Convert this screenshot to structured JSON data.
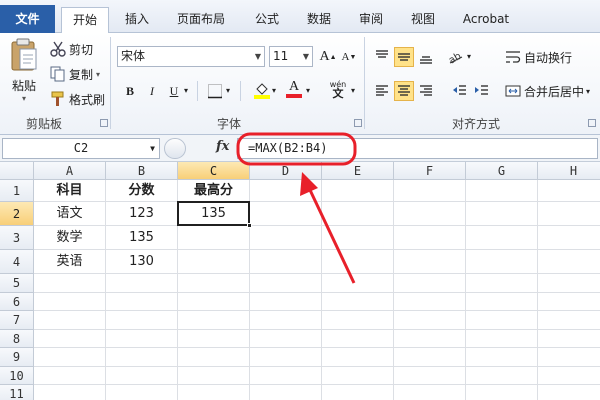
{
  "tabs": [
    {
      "label": "文件"
    },
    {
      "label": "开始"
    },
    {
      "label": "插入"
    },
    {
      "label": "页面布局"
    },
    {
      "label": "公式"
    },
    {
      "label": "数据"
    },
    {
      "label": "审阅"
    },
    {
      "label": "视图"
    },
    {
      "label": "Acrobat"
    }
  ],
  "clipboard": {
    "paste_label": "粘贴",
    "cut_label": "剪切",
    "copy_label": "复制",
    "format_painter_label": "格式刷",
    "group_label": "剪贴板"
  },
  "font": {
    "name": "宋体",
    "size": "11",
    "grow": "A",
    "shrink": "A",
    "bold": "B",
    "italic": "I",
    "underline": "U",
    "font_color": "A",
    "phonetic": "wén",
    "group_label": "字体"
  },
  "alignment": {
    "wrap_text_label": "自动换行",
    "merge_center_label": "合并后居中",
    "group_label": "对齐方式"
  },
  "formula_bar": {
    "name_box": "C2",
    "fx": "fx",
    "formula": "=MAX(B2:B4)"
  },
  "sheet": {
    "columns": [
      "A",
      "B",
      "C",
      "D",
      "E",
      "F",
      "G",
      "H"
    ],
    "rows": [
      "1",
      "2",
      "3",
      "4",
      "5",
      "6",
      "7",
      "8",
      "9",
      "10",
      "11"
    ],
    "selected_col": "C",
    "selected_row": "2",
    "cells": {
      "A1": "科目",
      "B1": "分数",
      "C1": "最高分",
      "A2": "语文",
      "B2": "123",
      "C2": "135",
      "A3": "数学",
      "B3": "135",
      "A4": "英语",
      "B4": "130"
    }
  },
  "colors": {
    "accent": "#2a5fa8",
    "annotation": "#e8202a",
    "selection_header": "#f8cf78"
  }
}
